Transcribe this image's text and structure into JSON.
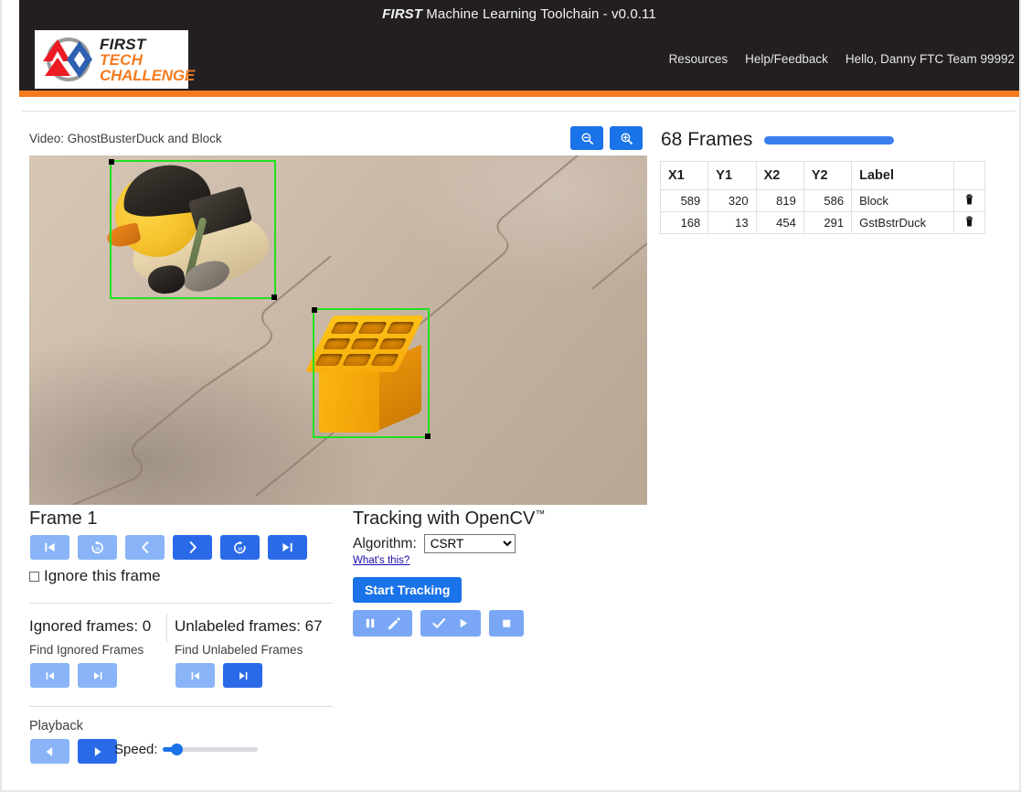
{
  "header": {
    "brand": "FIRST",
    "title_rest": " Machine Learning Toolchain - v0.0.11",
    "logo": {
      "first": "FIRST",
      "tech": "TECH",
      "challenge": "CHALLENGE"
    },
    "nav": [
      {
        "label": "Resources",
        "name": "nav-resources"
      },
      {
        "label": "Help/Feedback",
        "name": "nav-help-feedback"
      },
      {
        "label": "Hello, Danny FTC Team 99992",
        "name": "nav-user-greeting"
      }
    ],
    "accent_color": "#f47b20",
    "background_color": "#231f20"
  },
  "video": {
    "label": "Video: GhostBusterDuck and Block",
    "zoom_out_icon": "magnifier-minus-icon",
    "zoom_in_icon": "magnifier-plus-icon",
    "boxes": [
      {
        "label": "GstBstrDuck",
        "color": "#22e022"
      },
      {
        "label": "Block",
        "color": "#22e022"
      }
    ]
  },
  "frames_panel": {
    "count_text": "68 Frames",
    "progress_color": "#3b7ef0",
    "columns": [
      "X1",
      "Y1",
      "X2",
      "Y2",
      "Label",
      ""
    ],
    "rows": [
      {
        "x1": "589",
        "y1": "320",
        "x2": "819",
        "y2": "586",
        "label": "Block",
        "delete_icon": "trash-icon"
      },
      {
        "x1": "168",
        "y1": "13",
        "x2": "454",
        "y2": "291",
        "label": "GstBstrDuck",
        "delete_icon": "trash-icon"
      }
    ]
  },
  "frame_controls": {
    "title": "Frame 1",
    "buttons": [
      {
        "name": "first-frame-button",
        "icon": "skip-to-start-icon",
        "active": false
      },
      {
        "name": "back-ten-frames-button",
        "icon": "replay-10-icon",
        "active": false
      },
      {
        "name": "previous-frame-button",
        "icon": "chevron-left-icon",
        "active": false
      },
      {
        "name": "next-frame-button",
        "icon": "chevron-right-icon",
        "active": true
      },
      {
        "name": "forward-ten-frames-button",
        "icon": "forward-10-icon",
        "active": true
      },
      {
        "name": "last-frame-button",
        "icon": "skip-to-end-icon",
        "active": true
      }
    ],
    "ignore_checkbox_label": "Ignore this frame",
    "ignore_checked": false
  },
  "counters": {
    "ignored": {
      "title": "Ignored frames: 0",
      "find_label": "Find Ignored Frames",
      "prev": {
        "name": "find-previous-ignored-button",
        "icon": "skip-to-start-icon",
        "active": false
      },
      "next": {
        "name": "find-next-ignored-button",
        "icon": "skip-to-end-icon",
        "active": false
      }
    },
    "unlabeled": {
      "title": "Unlabeled frames: 67",
      "find_label": "Find Unlabeled Frames",
      "prev": {
        "name": "find-previous-unlabeled-button",
        "icon": "skip-to-start-icon",
        "active": false
      },
      "next": {
        "name": "find-next-unlabeled-button",
        "icon": "skip-to-end-icon",
        "active": true
      }
    }
  },
  "playback": {
    "label": "Playback",
    "reverse": {
      "name": "play-reverse-button",
      "icon": "play-left-icon",
      "active": false
    },
    "forward": {
      "name": "play-forward-button",
      "icon": "play-right-icon",
      "active": true
    },
    "speed_label": "Speed:",
    "speed_value": 10
  },
  "tracking": {
    "title": "Tracking with OpenCV",
    "trademark": "™",
    "algorithm_label": "Algorithm:",
    "algorithm_value": "CSRT",
    "algorithm_options": [
      "CSRT"
    ],
    "whats_this_label": "What's this?",
    "start_label": "Start Tracking",
    "buttons": [
      {
        "name": "pause-edit-tracking-button",
        "icons": [
          "pause-icon",
          "pencil-icon"
        ]
      },
      {
        "name": "accept-continue-tracking-button",
        "icons": [
          "check-icon",
          "play-icon"
        ]
      },
      {
        "name": "stop-tracking-button",
        "icons": [
          "stop-icon"
        ]
      }
    ]
  }
}
